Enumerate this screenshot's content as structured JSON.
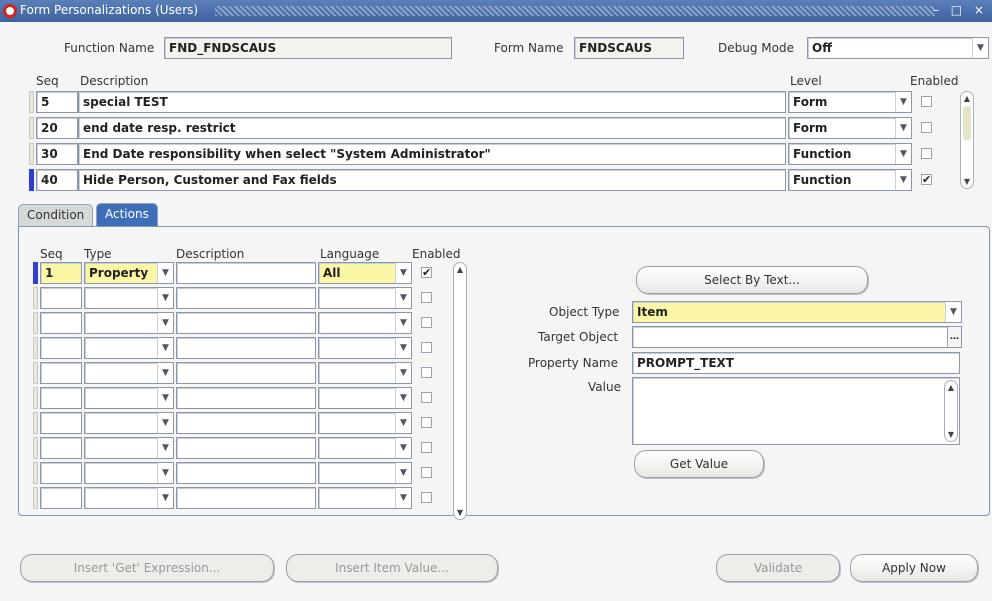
{
  "window": {
    "title": "Form Personalizations (Users)",
    "controls": "– □ ×"
  },
  "header": {
    "function_name_label": "Function Name",
    "function_name": "FND_FNDSCAUS",
    "form_name_label": "Form Name",
    "form_name": "FNDSCAUS",
    "debug_mode_label": "Debug Mode",
    "debug_mode": "Off"
  },
  "rules": {
    "headers": {
      "seq": "Seq",
      "description": "Description",
      "level": "Level",
      "enabled": "Enabled"
    },
    "rows": [
      {
        "seq": "5",
        "description": "special TEST",
        "level": "Form",
        "enabled": false
      },
      {
        "seq": "20",
        "description": "end date resp. restrict",
        "level": "Form",
        "enabled": false
      },
      {
        "seq": "30",
        "description": "End Date responsibility when select \"System Administrator\"",
        "level": "Function",
        "enabled": false
      },
      {
        "seq": "40",
        "description": "Hide Person, Customer and Fax fields",
        "level": "Function",
        "enabled": true
      }
    ]
  },
  "tabs": [
    {
      "label": "Condition",
      "active": false
    },
    {
      "label": "Actions",
      "active": true
    }
  ],
  "actions": {
    "headers": {
      "seq": "Seq",
      "type": "Type",
      "description": "Description",
      "language": "Language",
      "enabled": "Enabled"
    },
    "rows": [
      {
        "seq": "1",
        "type": "Property",
        "description": "",
        "language": "All",
        "enabled": true
      },
      {
        "seq": "",
        "type": "",
        "description": "",
        "language": "",
        "enabled": false
      },
      {
        "seq": "",
        "type": "",
        "description": "",
        "language": "",
        "enabled": false
      },
      {
        "seq": "",
        "type": "",
        "description": "",
        "language": "",
        "enabled": false
      },
      {
        "seq": "",
        "type": "",
        "description": "",
        "language": "",
        "enabled": false
      },
      {
        "seq": "",
        "type": "",
        "description": "",
        "language": "",
        "enabled": false
      },
      {
        "seq": "",
        "type": "",
        "description": "",
        "language": "",
        "enabled": false
      },
      {
        "seq": "",
        "type": "",
        "description": "",
        "language": "",
        "enabled": false
      },
      {
        "seq": "",
        "type": "",
        "description": "",
        "language": "",
        "enabled": false
      },
      {
        "seq": "",
        "type": "",
        "description": "",
        "language": "",
        "enabled": false
      }
    ]
  },
  "detail": {
    "select_by_text_label": "Select By Text...",
    "object_type_label": "Object Type",
    "object_type": "Item",
    "target_object_label": "Target Object",
    "target_object": "",
    "property_name_label": "Property Name",
    "property_name": "PROMPT_TEXT",
    "value_label": "Value",
    "value": "",
    "get_value_label": "Get Value"
  },
  "footer": {
    "insert_get_expression": "Insert 'Get' Expression...",
    "insert_item_value": "Insert Item Value...",
    "validate": "Validate",
    "apply_now": "Apply Now"
  }
}
